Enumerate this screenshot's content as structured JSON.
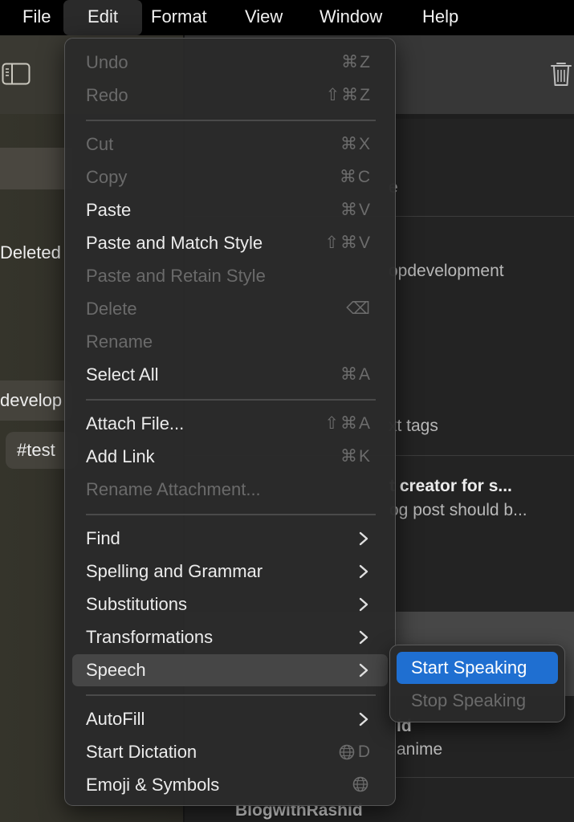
{
  "menubar": {
    "items": [
      {
        "label": "File"
      },
      {
        "label": "Edit",
        "active": true
      },
      {
        "label": "Format"
      },
      {
        "label": "View"
      },
      {
        "label": "Window"
      },
      {
        "label": "Help"
      }
    ]
  },
  "sidebar": {
    "toggle_icon": "sidebar-toggle-icon",
    "items": [
      {
        "label": "Deleted"
      },
      {
        "label": "develop"
      },
      {
        "label": "#test"
      }
    ]
  },
  "toolbar": {
    "trash_icon": "trash-icon"
  },
  "note_list": {
    "fragments": [
      {
        "text": "e"
      },
      {
        "text": "opdevelopment"
      },
      {
        "text": "xt tags"
      },
      {
        "title": "t creator for s...",
        "text": "og post should b..."
      },
      {
        "title": "id",
        "text": "anime"
      },
      {
        "title": "BlogwithRashid"
      }
    ]
  },
  "edit_menu": {
    "items": [
      {
        "label": "Undo",
        "shortcut": "⌘Z",
        "disabled": true
      },
      {
        "label": "Redo",
        "shortcut": "⇧⌘Z",
        "disabled": true
      },
      {
        "separator": true
      },
      {
        "label": "Cut",
        "shortcut": "⌘X",
        "disabled": true
      },
      {
        "label": "Copy",
        "shortcut": "⌘C",
        "disabled": true
      },
      {
        "label": "Paste",
        "shortcut": "⌘V",
        "disabled": false
      },
      {
        "label": "Paste and Match Style",
        "shortcut": "⇧⌘V",
        "disabled": false
      },
      {
        "label": "Paste and Retain Style",
        "shortcut": "",
        "disabled": true
      },
      {
        "label": "Delete",
        "shortcut": "⌫",
        "disabled": true
      },
      {
        "label": "Rename",
        "shortcut": "",
        "disabled": true
      },
      {
        "label": "Select All",
        "shortcut": "⌘A",
        "disabled": false
      },
      {
        "separator": true
      },
      {
        "label": "Attach File...",
        "shortcut": "⇧⌘A",
        "disabled": false
      },
      {
        "label": "Add Link",
        "shortcut": "⌘K",
        "disabled": false
      },
      {
        "label": "Rename Attachment...",
        "shortcut": "",
        "disabled": true
      },
      {
        "separator": true
      },
      {
        "label": "Find",
        "submenu": true
      },
      {
        "label": "Spelling and Grammar",
        "submenu": true
      },
      {
        "label": "Substitutions",
        "submenu": true
      },
      {
        "label": "Transformations",
        "submenu": true
      },
      {
        "label": "Speech",
        "submenu": true,
        "highlighted": true
      },
      {
        "separator": true
      },
      {
        "label": "AutoFill",
        "submenu": true
      },
      {
        "label": "Start Dictation",
        "shortcut": "🌐D",
        "globe": true,
        "key": "D"
      },
      {
        "label": "Emoji & Symbols",
        "shortcut": "🌐",
        "globe": true,
        "key": ""
      }
    ]
  },
  "speech_submenu": {
    "items": [
      {
        "label": "Start Speaking",
        "selected": true,
        "disabled": false
      },
      {
        "label": "Stop Speaking",
        "selected": false,
        "disabled": true
      }
    ]
  },
  "colors": {
    "accent": "#1f6fd1",
    "menu_bg": "#2a2a2a",
    "disabled_text": "#6a6a6a"
  }
}
